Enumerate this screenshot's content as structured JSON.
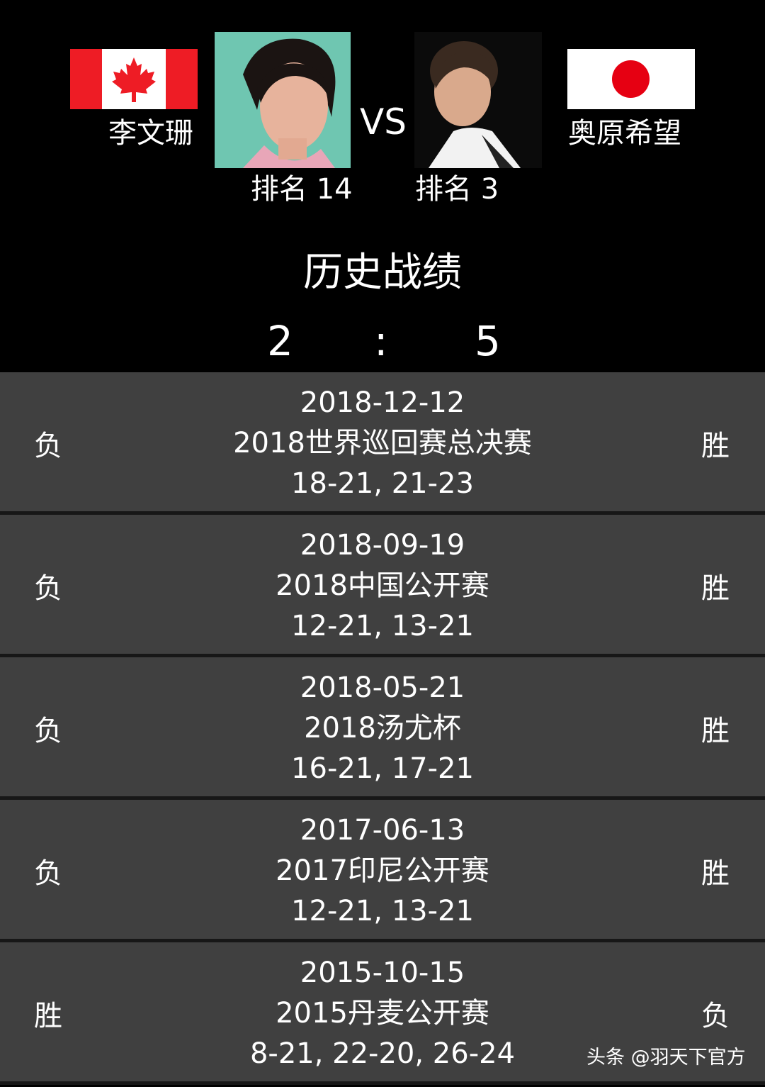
{
  "header": {
    "player_left": {
      "name": "李文珊",
      "rank_label": "排名 14",
      "flag": "canada-flag"
    },
    "player_right": {
      "name": "奥原希望",
      "rank_label": "排名 3",
      "flag": "japan-flag"
    },
    "vs_label": "VS",
    "history_title": "历史战绩",
    "score_left": "2",
    "score_separator": ":",
    "score_right": "5"
  },
  "matches": [
    {
      "date": "2018-12-12",
      "event": "2018世界巡回赛总决赛",
      "score": "18-21, 21-23",
      "left_result": "负",
      "right_result": "胜"
    },
    {
      "date": "2018-09-19",
      "event": "2018中国公开赛",
      "score": "12-21, 13-21",
      "left_result": "负",
      "right_result": "胜"
    },
    {
      "date": "2018-05-21",
      "event": "2018汤尤杯",
      "score": "16-21, 17-21",
      "left_result": "负",
      "right_result": "胜"
    },
    {
      "date": "2017-06-13",
      "event": "2017印尼公开赛",
      "score": "12-21, 13-21",
      "left_result": "负",
      "right_result": "胜"
    },
    {
      "date": "2015-10-15",
      "event": "2015丹麦公开赛",
      "score": "8-21, 22-20, 26-24",
      "left_result": "胜",
      "right_result": "负"
    }
  ],
  "watermark": "头条 @羽天下官方",
  "colors": {
    "background": "#000000",
    "row_background": "#404040",
    "row_divider": "#171717",
    "canada_red": "#ee1c25",
    "japan_red": "#e60012"
  }
}
